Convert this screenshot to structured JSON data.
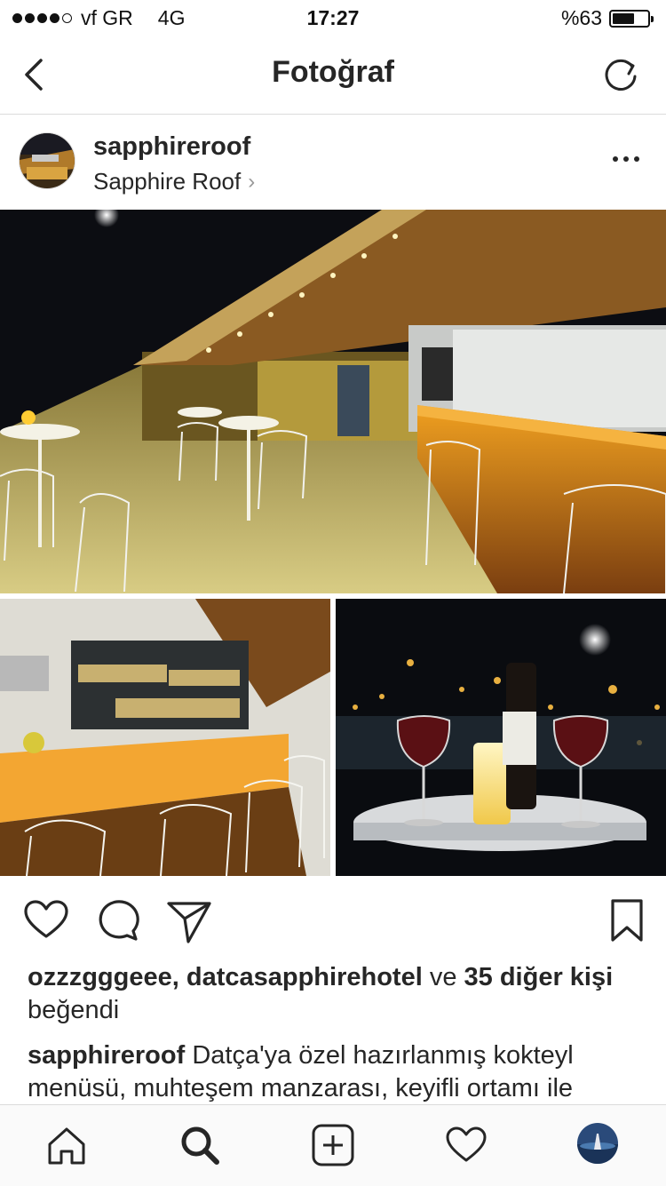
{
  "status_bar": {
    "carrier": "vf GR",
    "network": "4G",
    "time": "17:27",
    "battery_text": "%63",
    "battery_level": 0.63,
    "signal_bars": 4,
    "signal_total": 5
  },
  "nav": {
    "title": "Fotoğraf",
    "back_icon": "chevron-left-icon",
    "refresh_icon": "refresh-icon"
  },
  "post": {
    "username": "sapphireroof",
    "location": "Sapphire Roof",
    "more_icon": "more-horizontal-icon"
  },
  "photo": {
    "panels": [
      {
        "name": "rooftop-lounge",
        "description_icon": "restaurant-interior-photo"
      },
      {
        "name": "bar-counter",
        "description_icon": "bar-photo"
      },
      {
        "name": "wine-table",
        "description_icon": "wine-photo"
      }
    ]
  },
  "actions": {
    "like_icon": "heart-icon",
    "comment_icon": "comment-icon",
    "share_icon": "send-icon",
    "save_icon": "bookmark-icon"
  },
  "likes": {
    "users": "ozzzgggeee, datcasapphirehotel",
    "conjunction": "ve",
    "others": "35 diğer kişi",
    "suffix": "beğendi"
  },
  "caption": {
    "username": "sapphireroof",
    "text": "Datça'ya özel hazırlanmış kokteyl menüsü, muhteşem manzarası, keyifli ortamı ile"
  },
  "tab_bar": {
    "items": [
      "home-icon",
      "search-icon",
      "add-icon",
      "activity-heart-icon",
      "profile-avatar"
    ],
    "active": "search-icon"
  }
}
